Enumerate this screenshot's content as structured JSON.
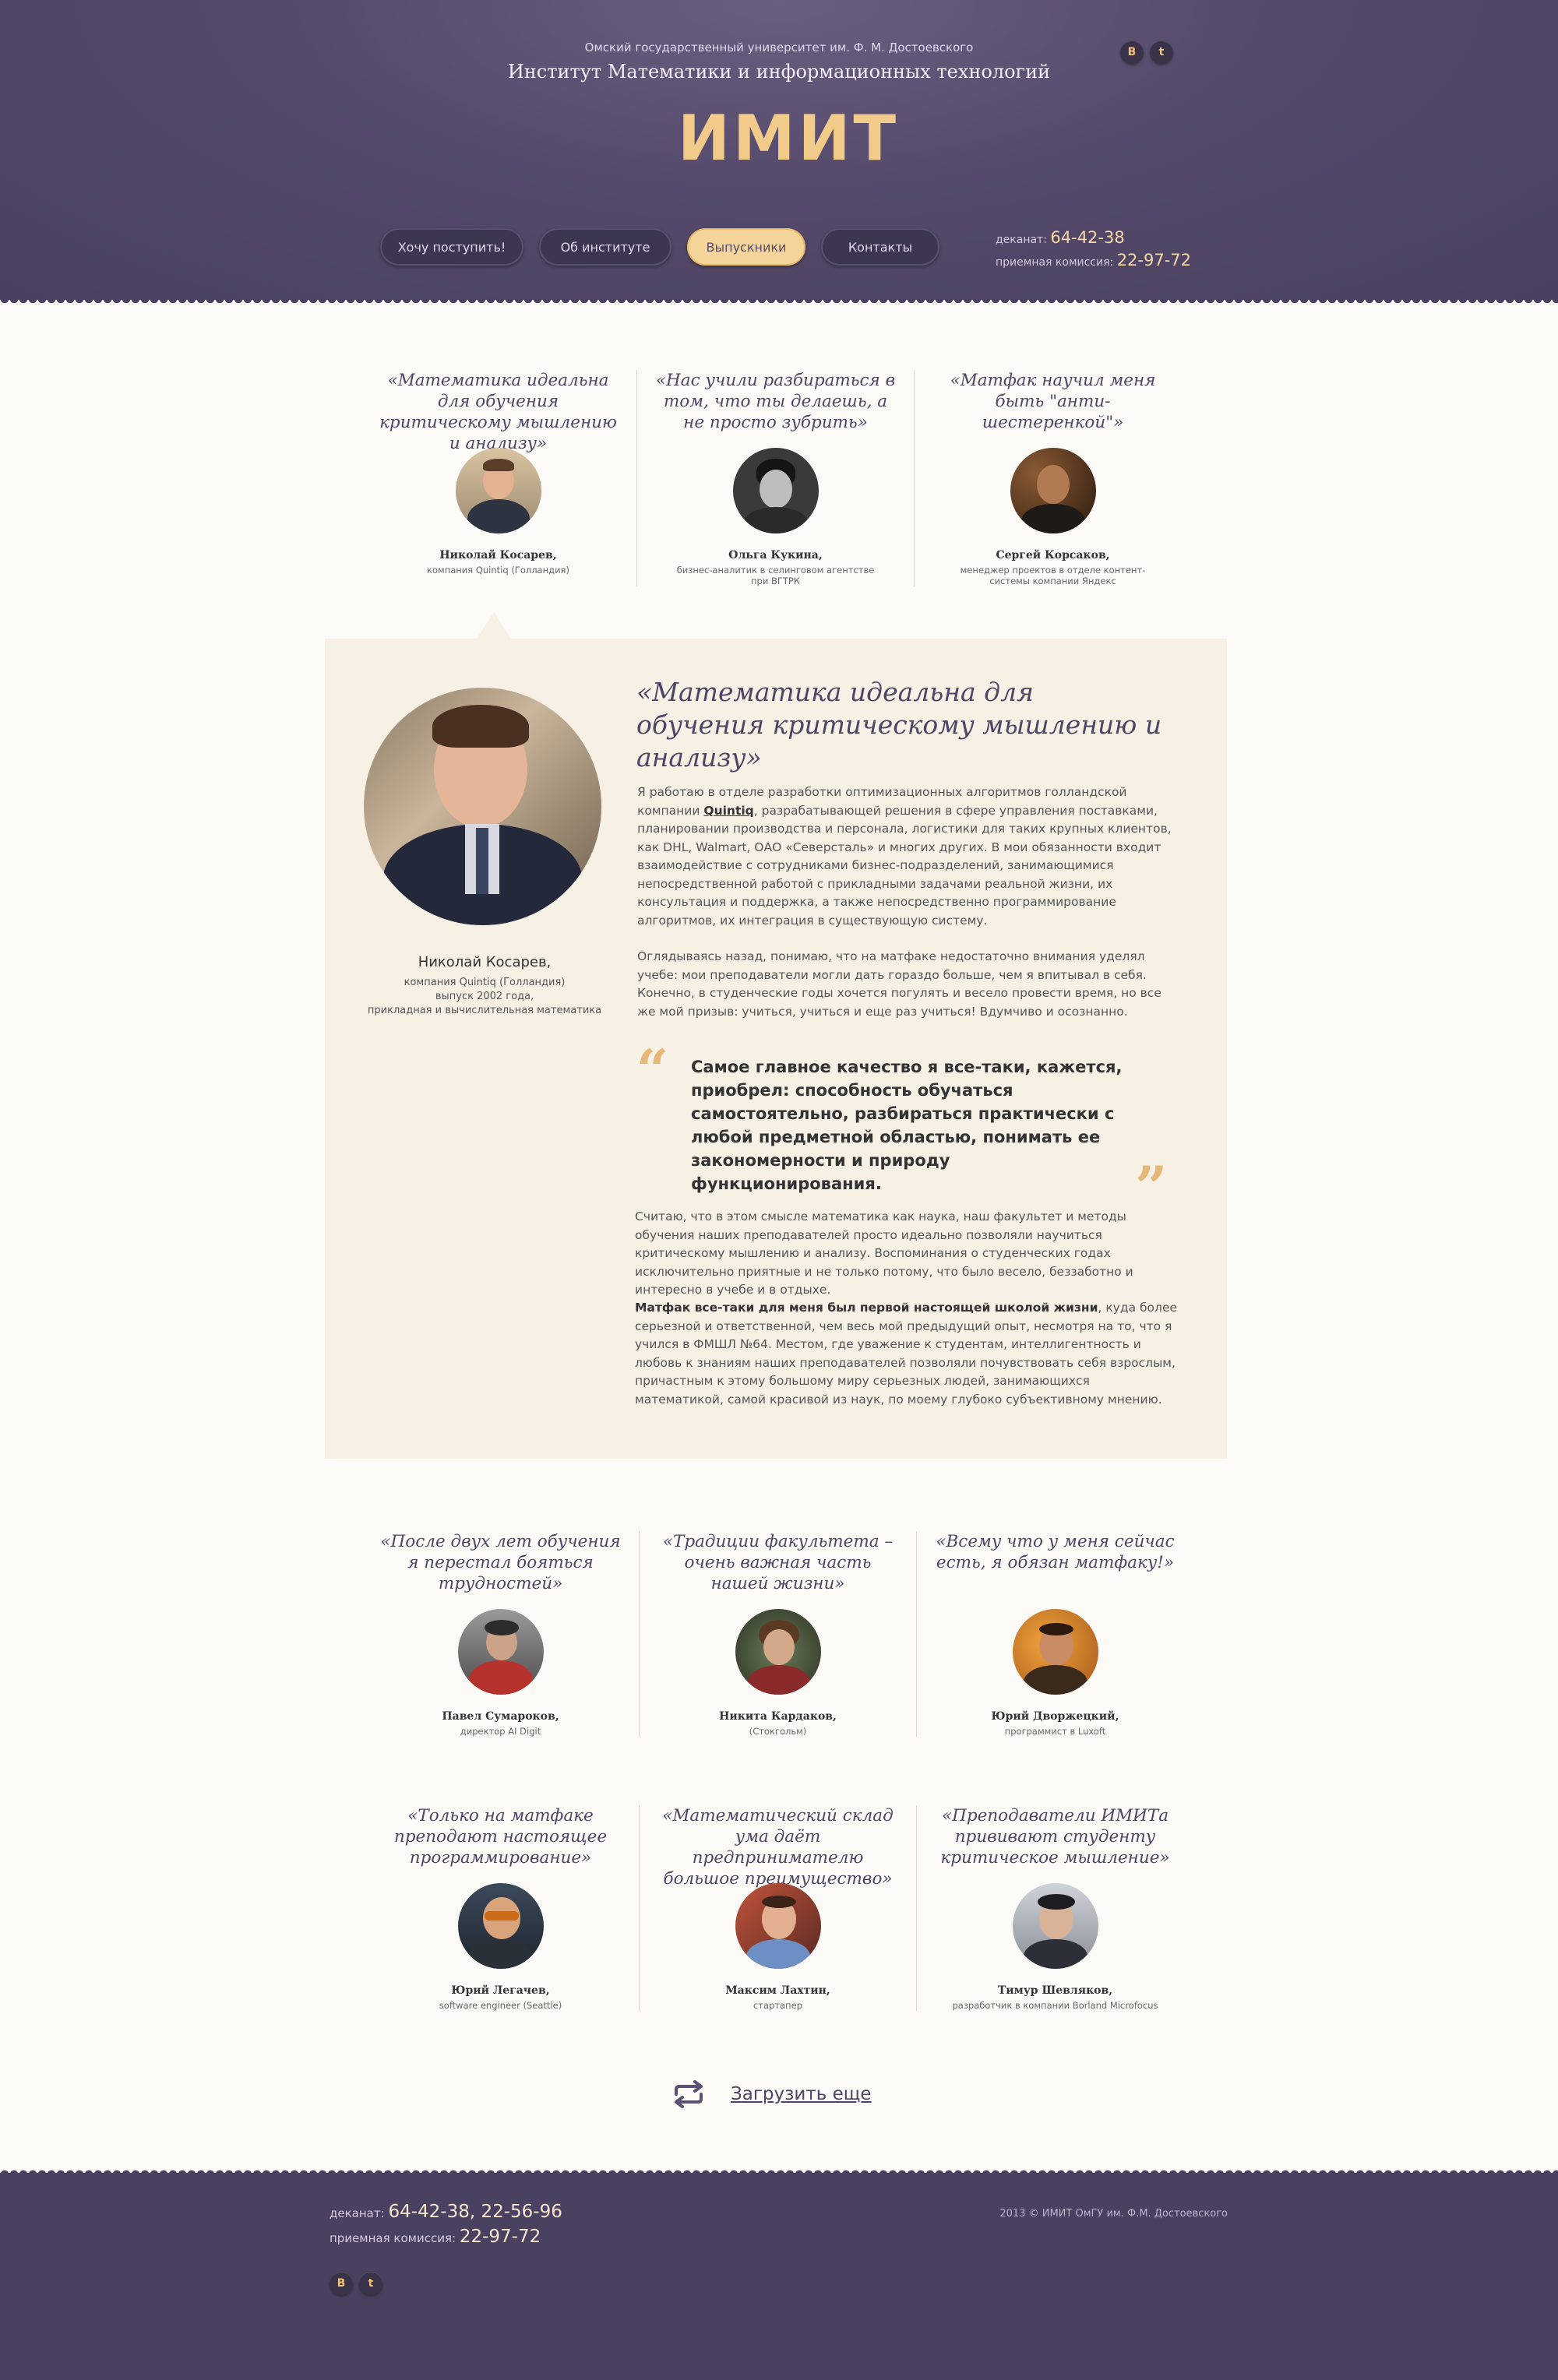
{
  "header": {
    "university": "Омский государственный университет им. Ф. М. Достоевского",
    "institute": "Институт Математики и информационных технологий",
    "logo": "ИМИТ",
    "social": [
      "В",
      "t"
    ],
    "nav": [
      {
        "label": "Хочу поступить!"
      },
      {
        "label": "Об институте"
      },
      {
        "label": "Выпускники"
      },
      {
        "label": "Контакты"
      }
    ],
    "phones": {
      "dean_label": "деканат:",
      "dean_number": "64-42-38",
      "admission_label": "приемная комиссия:",
      "admission_number": "22-97-72"
    }
  },
  "top_testimonials": [
    {
      "quote": "«Математика идеальна для обучения критическому мышлению и анализу»",
      "name": "Николай Косарев,",
      "role": "компания Quintiq (Голландия)"
    },
    {
      "quote": "«Нас учили разбираться в том, что ты делаешь, а не просто зубрить»",
      "name": "Ольга Кукина,",
      "role": "бизнес-аналитик в селинговом агентстве при ВГТРК"
    },
    {
      "quote": "«Матфак научил меня быть \"анти-шестеренкой\"»",
      "name": "Сергей Корсаков,",
      "role": "менеджер проектов в отделе контент-системы компании Яндекс"
    }
  ],
  "featured": {
    "title": "«Математика идеальна для обучения критическому мышлению и анализу»",
    "name": "Николай Косарев,",
    "company": "компания Quintiq (Голландия)",
    "graduation": "выпуск 2002 года,",
    "specialty": "прикладная и вычислительная математика",
    "p1_start": "Я работаю в отделе разработки оптимизационных алгоритмов голландской компании ",
    "p1_link": "Quintiq",
    "p1_end": ", разрабатывающей решения в сфере управления поставками, планировании производства и персонала, логистики для таких крупных клиентов, как DHL, Walmart, ОАО «Северсталь» и многих других. В мои обязанности входит взаимодействие с сотрудниками бизнес-подразделений, занимающимися непосредственной работой с прикладными задачами реальной жизни, их консультация и поддержка, а также непосредственно программирование алгоритмов, их интеграция в существующую систему.",
    "p2": "Оглядываясь назад, понимаю, что на матфаке недостаточно внимания уделял учебе: мои преподаватели могли дать гораздо больше, чем я впитывал в себя. Конечно, в студенческие годы хочется погулять и весело провести время, но все же мой призыв: учиться, учиться и еще раз учиться! Вдумчиво и осознанно.",
    "pull_quote": "Самое главное качество я все-таки, кажется, приобрел: способность обучаться самостоятельно, разбираться практически с любой предметной областью, понимать ее закономерности и природу функционирования.",
    "p3": "Считаю, что в этом смысле математика как наука, наш факультет и методы обучения наших преподавателей просто идеально позволяли научиться критическому мышлению и анализу. Воспоминания о студенческих годах исключительно приятные и не только потому, что было весело, беззаботно и интересно в учебе и в отдыхе.",
    "p4_bold": "Матфак все-таки для меня был первой настоящей школой жизни",
    "p4_rest": ", куда более серьезной и ответственной, чем весь мой предыдущий опыт, несмотря на то, что я учился в ФМШЛ №64. Местом, где уважение к студентам, интеллигентность и любовь к знаниям наших преподавателей позволяли почувствовать себя взрослым, причастным к этому большому миру серьезных людей, занимающихся математикой, самой красивой из наук, по моему глубоко субъективному мнению."
  },
  "row2": [
    {
      "quote": "«После двух лет обучения я перестал бояться трудностей»",
      "name": "Павел Сумароков,",
      "role": "директор AI Digit"
    },
    {
      "quote": "«Традиции факультета – очень важная часть нашей жизни»",
      "name": "Никита Кардаков,",
      "role": "(Стокгольм)"
    },
    {
      "quote": "«Всему что у меня сейчас есть, я обязан матфаку!»",
      "name": "Юрий Дворжецкий,",
      "role": "программист в Luxoft"
    }
  ],
  "row3": [
    {
      "quote": "«Только на матфаке преподают настоящее программирование»",
      "name": "Юрий Легачев,",
      "role": "software engineer (Seattle)"
    },
    {
      "quote": "«Математический склад ума даёт предпринимателю большое преимущество»",
      "name": "Максим Лахтин,",
      "role": "стартапер"
    },
    {
      "quote": "«Преподаватели ИМИТа прививают студенту критическое мышление»",
      "name": "Тимур Шевляков,",
      "role": "разработчик в компании Borland Microfocus"
    }
  ],
  "load_more": "Загрузить еще",
  "footer": {
    "dean_label": "деканат:",
    "dean_number": "64-42-38, 22-56-96",
    "admission_label": "приемная комиссия:",
    "admission_number": "22-97-72",
    "copyright": "2013 © ИМИТ ОмГУ им. Ф.М. Достоевского",
    "social": [
      "В",
      "t"
    ]
  },
  "colors": {
    "header_bg": "#4e4463",
    "accent": "#f5d49a",
    "quote_text": "#4e4565",
    "featured_bg": "#f7f0e5"
  }
}
